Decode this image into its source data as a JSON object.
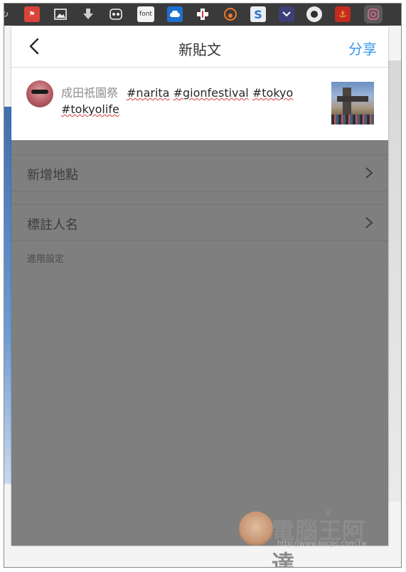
{
  "toolbar": {
    "icons": [
      "refresh-icon",
      "badge-icon",
      "image-icon",
      "download-icon",
      "ghostery-icon",
      "font-icon",
      "cloud-icon",
      "plus-icon",
      "bitly-icon",
      "s-icon",
      "pocket-icon",
      "tracker-icon",
      "red-ext-icon",
      "instagram-icon"
    ],
    "font_label": "font"
  },
  "nav": {
    "title": "新貼文",
    "share_label": "分享"
  },
  "post": {
    "caption_text": "成田祇園祭",
    "hashtags": [
      "#narita",
      "#gionfestival",
      "#tokyo",
      "#tokyolife"
    ]
  },
  "menu": {
    "add_location": "新增地點",
    "tag_people": "標註人名",
    "advanced_settings": "進階設定"
  },
  "watermark": {
    "brand": "電腦王阿達",
    "url": "http://www.kocpc.com.tw"
  },
  "colors": {
    "accent": "#3897f0",
    "overlay": "#7f7f7f"
  }
}
